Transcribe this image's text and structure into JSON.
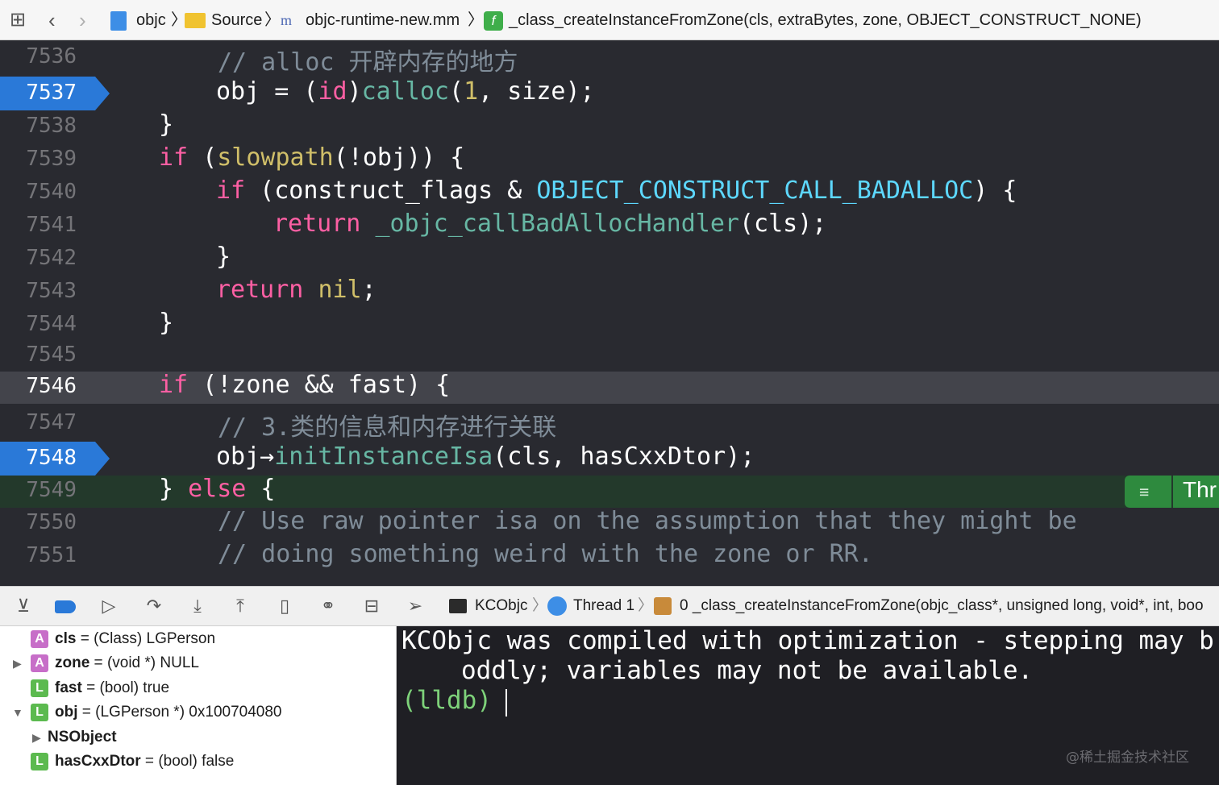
{
  "jumpbar": {
    "items": [
      "objc",
      "Source",
      "objc-runtime-new.mm",
      "_class_createInstanceFromZone(cls, extraBytes, zone, OBJECT_CONSTRUCT_NONE)"
    ]
  },
  "editor": {
    "lines": [
      {
        "num": "7536",
        "text": "// alloc 开辟内存的地方"
      },
      {
        "num": "7537",
        "text": "obj = (id)calloc(1, size);",
        "breakpoint": true
      },
      {
        "num": "7538",
        "text": "}"
      },
      {
        "num": "7539",
        "text": "if (slowpath(!obj)) {"
      },
      {
        "num": "7540",
        "text": "if (construct_flags & OBJECT_CONSTRUCT_CALL_BADALLOC) {"
      },
      {
        "num": "7541",
        "text": "return _objc_callBadAllocHandler(cls);"
      },
      {
        "num": "7542",
        "text": "}"
      },
      {
        "num": "7543",
        "text": "return nil;"
      },
      {
        "num": "7544",
        "text": "}"
      },
      {
        "num": "7545",
        "text": ""
      },
      {
        "num": "7546",
        "text": "if (!zone && fast) {",
        "highlight": true
      },
      {
        "num": "7547",
        "text": "// 3.类的信息和内存进行关联"
      },
      {
        "num": "7548",
        "text": "obj->initInstanceIsa(cls, hasCxxDtor);",
        "breakpoint": true
      },
      {
        "num": "7549",
        "text": "} else {",
        "current": true
      },
      {
        "num": "7550",
        "text": "// Use raw pointer isa on the assumption that they might be"
      },
      {
        "num": "7551",
        "text": "// doing something weird with the zone or RR."
      }
    ],
    "thread_badge": "Thr"
  },
  "debugbar": {
    "target": "KCObjc",
    "thread": "Thread 1",
    "frame": "0 _class_createInstanceFromZone(objc_class*, unsigned long, void*, int, boo"
  },
  "variables": [
    {
      "kind": "A",
      "name": "cls",
      "value": "(Class) LGPerson"
    },
    {
      "kind": "A",
      "name": "zone",
      "value": "(void *) NULL"
    },
    {
      "kind": "L",
      "name": "fast",
      "value": "(bool) true"
    },
    {
      "kind": "L",
      "name": "obj",
      "value": "(LGPerson *) 0x100704080"
    },
    {
      "kind": "",
      "name": "NSObject",
      "value": ""
    },
    {
      "kind": "L",
      "name": "hasCxxDtor",
      "value": "(bool) false"
    }
  ],
  "console": {
    "line1": "KCObjc was compiled with optimization - stepping may b",
    "line2": "oddly; variables may not be available.",
    "prompt": "(lldb)",
    "watermark": "@稀土掘金技术社区"
  },
  "colors": {
    "breakpoint": "#2a79d8",
    "current_line": "#23392b",
    "keyword": "#fc5fa3",
    "function": "#67b7a4"
  }
}
